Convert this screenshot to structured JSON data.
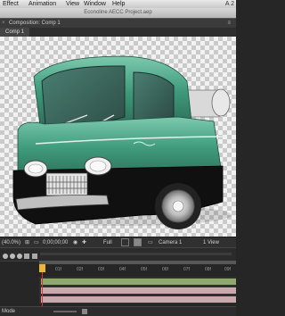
{
  "menubar": {
    "items": [
      "Effect",
      "Animation",
      "View",
      "Window",
      "Help"
    ],
    "app_badge": "A 2"
  },
  "window_title": "Econoline AECC Project.aep",
  "composition_panel": {
    "header": "Composition: Comp 1",
    "tab": "Comp 1"
  },
  "viewer_controls": {
    "zoom": "(40.0%)",
    "timecode": "0;00;00;00",
    "resolution": "Full",
    "camera": "Camera 1",
    "views": "1 View"
  },
  "timeline": {
    "ticks": [
      "01f",
      "02f",
      "03f",
      "04f",
      "05f",
      "06f",
      "07f",
      "08f",
      "09f"
    ],
    "bottom_label": "Mode"
  },
  "colors": {
    "accent": "#e9b73c",
    "playhead": "#dd3333",
    "layer_bar": "#c8a9ae",
    "layer_bar_green": "#8fa86f",
    "truck_body": "#3f9b7c"
  }
}
